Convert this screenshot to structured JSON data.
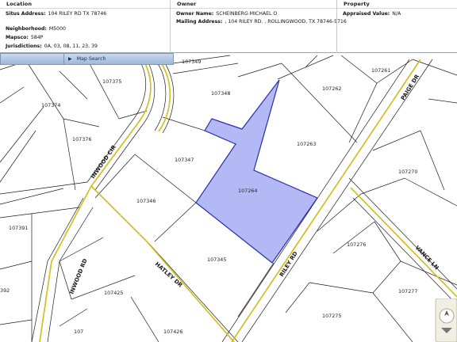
{
  "info": {
    "location": {
      "heading": "Location",
      "situs_label": "Situs Address:",
      "situs_value": "104 RILEY RD TX 78746",
      "neighborhood_label": "Neighborhood:",
      "neighborhood_value": "M5000",
      "mapsco_label": "Mapsco:",
      "mapsco_value": "584P",
      "jurisdictions_label": "Jurisdictions:",
      "jurisdictions_value": "0A, 03, 08, 11, 23, 39"
    },
    "owner": {
      "heading": "Owner",
      "name_label": "Owner Name:",
      "name_value": "SCHEINBERG MICHAEL O",
      "mailing_label": "Mailing Address:",
      "mailing_value": ", 104 RILEY RD. , ROLLINGWOOD, TX 78746-5716"
    },
    "property": {
      "heading": "Property",
      "appraised_label": "Appraised Value:",
      "appraised_value": "N/A"
    }
  },
  "toolbar": {
    "map_search_label": "Map Search"
  },
  "map": {
    "selected_parcel": "107264",
    "parcels": [
      "107349",
      "107375",
      "107348",
      "107261",
      "107262",
      "107374",
      "107376",
      "107263",
      "107347",
      "107264",
      "107270",
      "107346",
      "107391",
      "107345",
      "107276",
      "107425",
      "107277",
      "107426",
      "107275"
    ],
    "partial_parcels": [
      "392",
      "107"
    ],
    "streets": {
      "inwood_cir": "INWOOD CIR",
      "inwood_rd": "INWOOD RD",
      "hatley_dr": "HATLEY DR",
      "riley_rd": "RILEY RD",
      "paige_dr": "PAIGE DR",
      "vance_ln": "VANCE LN"
    },
    "colors": {
      "selected_fill": "#b3b9f4",
      "selected_stroke": "#2a2ab0",
      "road_center": "#c8b400"
    }
  }
}
